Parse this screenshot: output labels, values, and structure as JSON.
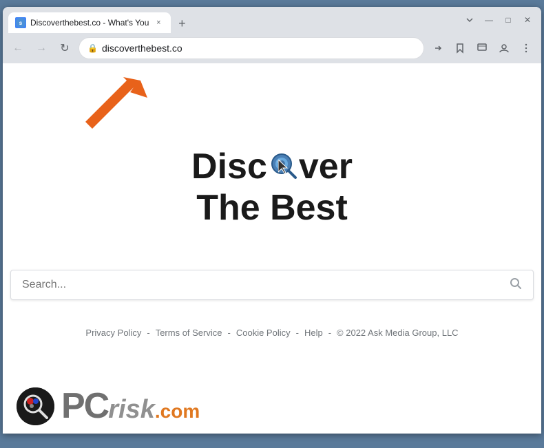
{
  "browser": {
    "tab": {
      "favicon_label": "s",
      "title": "Discoverthebest.co - What's You",
      "close_label": "×"
    },
    "new_tab_label": "+",
    "window_controls": {
      "minimize": "—",
      "maximize": "□",
      "close": "✕"
    },
    "toolbar": {
      "back_label": "←",
      "forward_label": "→",
      "reload_label": "↻",
      "address": "discoverthebest.co",
      "share_label": "↑",
      "bookmark_label": "☆",
      "tab_search_label": "▭",
      "profile_label": "👤",
      "menu_label": "⋮"
    }
  },
  "page": {
    "logo_line1_before": "Disc",
    "logo_line1_after": "ver",
    "logo_line2": "The Best",
    "search_placeholder": "Search...",
    "footer": {
      "privacy": "Privacy Policy",
      "sep1": "-",
      "terms": "Terms of Service",
      "sep2": "-",
      "cookie": "Cookie Policy",
      "sep3": "-",
      "help": "Help",
      "sep4": "-",
      "copyright": "© 2022 Ask Media Group, LLC"
    }
  },
  "watermark": {
    "pc_text": "PC",
    "risk_text": "risk",
    "com_text": ".com"
  }
}
